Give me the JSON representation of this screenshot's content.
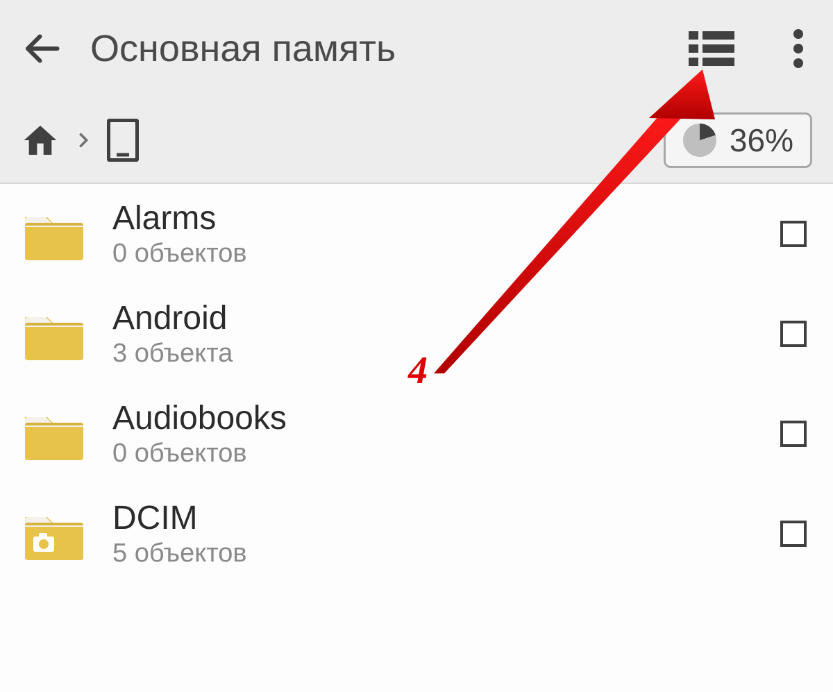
{
  "header": {
    "title": "Основная память"
  },
  "storage": {
    "percent": "36%"
  },
  "items": [
    {
      "name": "Alarms",
      "subtitle": "0 объектов",
      "icon": "folder"
    },
    {
      "name": "Android",
      "subtitle": "3 объекта",
      "icon": "folder"
    },
    {
      "name": "Audiobooks",
      "subtitle": "0 объектов",
      "icon": "folder"
    },
    {
      "name": "DCIM",
      "subtitle": "5 объектов",
      "icon": "folder-camera"
    }
  ],
  "annotation": {
    "number": "4"
  }
}
